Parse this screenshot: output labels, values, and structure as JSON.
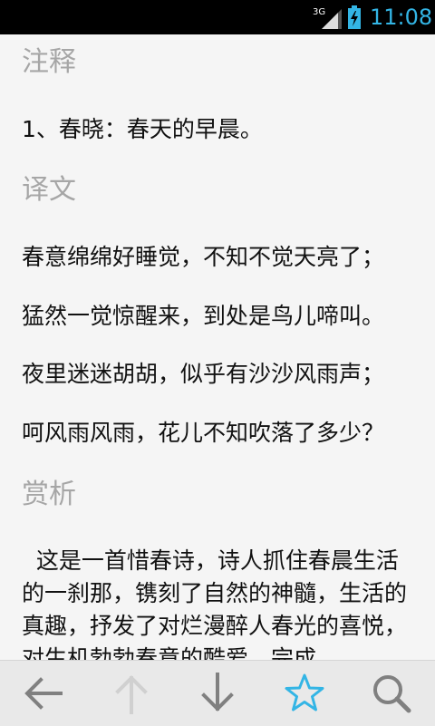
{
  "status_bar": {
    "network": "3G",
    "time": "11:08"
  },
  "sections": {
    "notes": {
      "title": "注释",
      "items": [
        "1、春晓：春天的早晨。"
      ]
    },
    "translation": {
      "title": "译文",
      "lines": [
        "春意绵绵好睡觉，不知不觉天亮了；",
        "猛然一觉惊醒来，到处是鸟儿啼叫。",
        "夜里迷迷胡胡，似乎有沙沙风雨声；",
        "呵风雨风雨，花儿不知吹落了多少？"
      ]
    },
    "analysis": {
      "title": "赏析",
      "text": "  这是一首惜春诗，诗人抓住春晨生活的一刹那，镌刻了自然的神髓，生活的真趣，抒发了对烂漫醉人春光的喜悦，对生机勃勃春意的酷爱。完成"
    }
  },
  "toolbar": {
    "icons": [
      "arrow-left-icon",
      "arrow-up-icon",
      "arrow-down-icon",
      "star-icon",
      "search-icon"
    ],
    "colors": {
      "active": "#808080",
      "disabled": "#d0d0d0",
      "accent": "#33b5e5"
    }
  }
}
